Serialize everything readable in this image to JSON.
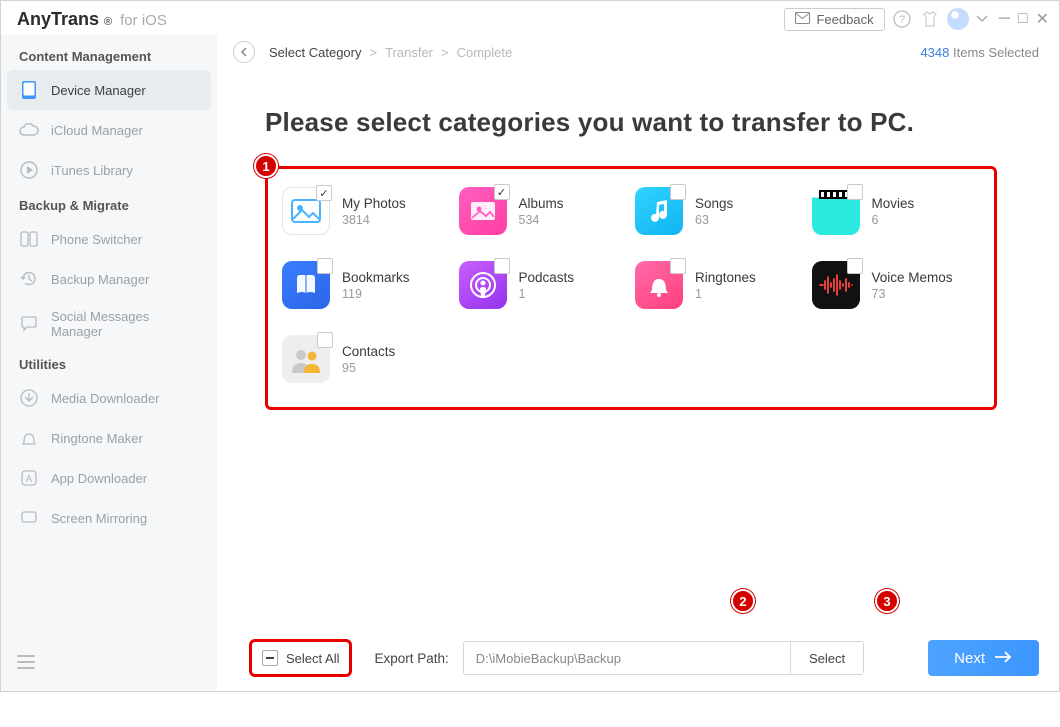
{
  "app": {
    "name": "AnyTrans",
    "platform": "for iOS"
  },
  "titlebar": {
    "feedback": "Feedback"
  },
  "breadcrumb": {
    "step1": "Select Category",
    "step2": "Transfer",
    "step3": "Complete"
  },
  "selection": {
    "count": "4348",
    "suffix": "Items Selected"
  },
  "sidebar": {
    "section1": "Content Management",
    "items1": [
      {
        "label": "Device Manager",
        "icon": "phone-icon",
        "active": true
      },
      {
        "label": "iCloud Manager",
        "icon": "cloud-icon"
      },
      {
        "label": "iTunes Library",
        "icon": "play-circle-icon"
      }
    ],
    "section2": "Backup & Migrate",
    "items2": [
      {
        "label": "Phone Switcher",
        "icon": "switch-icon"
      },
      {
        "label": "Backup Manager",
        "icon": "history-icon"
      },
      {
        "label": "Social Messages Manager",
        "icon": "chat-icon"
      }
    ],
    "section3": "Utilities",
    "items3": [
      {
        "label": "Media Downloader",
        "icon": "download-icon"
      },
      {
        "label": "Ringtone Maker",
        "icon": "bell-icon"
      },
      {
        "label": "App Downloader",
        "icon": "app-icon"
      },
      {
        "label": "Screen Mirroring",
        "icon": "mirror-icon"
      }
    ]
  },
  "main": {
    "title": "Please select categories you want to transfer to PC.",
    "categories": [
      {
        "name": "My Photos",
        "count": "3814",
        "checked": true,
        "iconClass": "ic-photos"
      },
      {
        "name": "Albums",
        "count": "534",
        "checked": true,
        "iconClass": "ic-albums"
      },
      {
        "name": "Songs",
        "count": "63",
        "checked": false,
        "iconClass": "ic-songs"
      },
      {
        "name": "Movies",
        "count": "6",
        "checked": false,
        "iconClass": "ic-movies"
      },
      {
        "name": "Bookmarks",
        "count": "119",
        "checked": false,
        "iconClass": "ic-bookmarks"
      },
      {
        "name": "Podcasts",
        "count": "1",
        "checked": false,
        "iconClass": "ic-podcasts"
      },
      {
        "name": "Ringtones",
        "count": "1",
        "checked": false,
        "iconClass": "ic-ringtones"
      },
      {
        "name": "Voice Memos",
        "count": "73",
        "checked": false,
        "iconClass": "ic-voice"
      },
      {
        "name": "Contacts",
        "count": "95",
        "checked": false,
        "iconClass": "ic-contacts"
      }
    ]
  },
  "bottom": {
    "selectAll": "Select All",
    "exportLabel": "Export Path:",
    "exportPath": "D:\\iMobieBackup\\Backup",
    "selectBtn": "Select",
    "nextBtn": "Next"
  },
  "annotations": {
    "b1": "1",
    "b2": "2",
    "b3": "3"
  }
}
